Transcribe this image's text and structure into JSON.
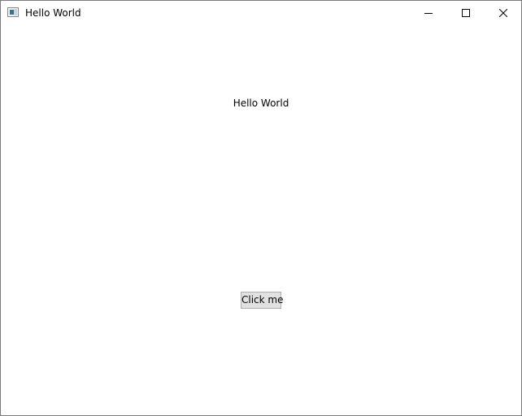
{
  "window": {
    "title": "Hello World",
    "icons": {
      "app": "app-window-icon",
      "minimize": "minimize-icon",
      "maximize": "maximize-icon",
      "close": "close-icon"
    }
  },
  "content": {
    "label": "Hello World",
    "button_label": "Click me"
  },
  "colors": {
    "window_border": "#7a7a7a",
    "button_bg": "#e1e1e1",
    "button_border": "#adadad",
    "text": "#000000"
  }
}
